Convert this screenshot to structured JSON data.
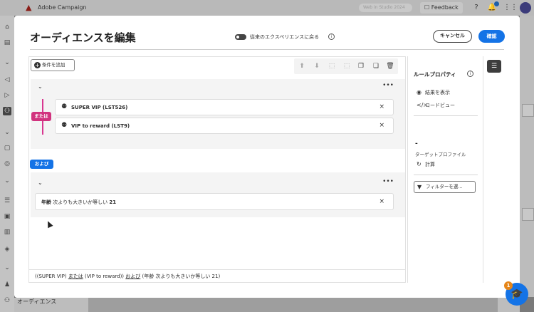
{
  "header": {
    "app_name": "Adobe Campaign",
    "search_placeholder": "Web in Studio 2024",
    "feedback_label": "Feedback",
    "notification_count": "1"
  },
  "background": {
    "sidebar_label": "オーディエンス"
  },
  "modal": {
    "title": "オーディエンスを編集",
    "toggle_label": "従来のエクスペリエンスに戻る",
    "cancel_label": "キャンセル",
    "confirm_label": "確認",
    "add_condition_label": "条件を追加",
    "or_label": "または",
    "and_label": "および",
    "rules": [
      {
        "text": "SUPER VIP (LST526)"
      },
      {
        "text": "VIP to reward (LST9)"
      }
    ],
    "age_rule": {
      "field": "年齢",
      "operator": "次よりも大きいか等しい",
      "value": "21"
    },
    "summary": {
      "part1": "((SUPER VIP)",
      "or": "または",
      "part2": "(VIP to reward))",
      "and": "および",
      "part3": "(年齢 次よりも大きいか等しい 21)"
    }
  },
  "properties": {
    "title": "ルールプロパティ",
    "show_results": "結果を表示",
    "code_view": "コードビュー",
    "count_value": "-",
    "target_profiles": "ターゲットプロファイル",
    "calculate": "計算",
    "filter_button": "フィルターを選..."
  },
  "help": {
    "badge": "1"
  }
}
